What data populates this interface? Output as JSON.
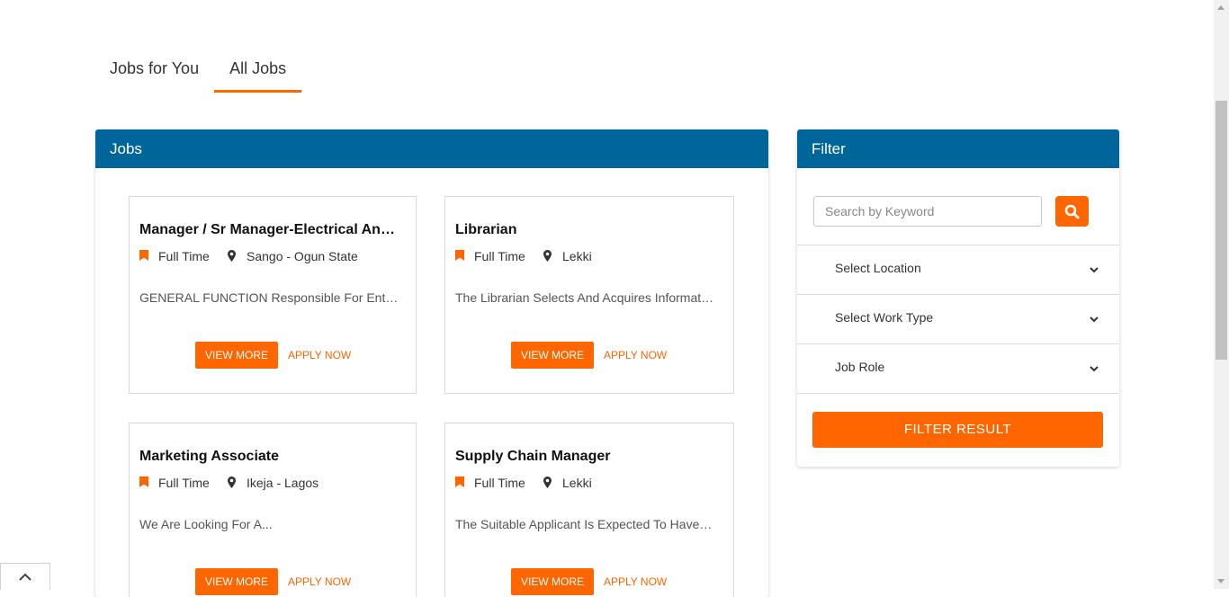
{
  "tabs": [
    {
      "label": "Jobs for You",
      "active": false
    },
    {
      "label": "All Jobs",
      "active": true
    }
  ],
  "jobs_panel": {
    "title": "Jobs",
    "cards": [
      {
        "title": "Manager / Sr Manager-Electrical And...",
        "type": "Full Time",
        "location": "Sango - Ogun State",
        "description": "GENERAL FUNCTION Responsible For Entire...",
        "view_label": "VIEW MORE",
        "apply_label": "APPLY NOW"
      },
      {
        "title": "Librarian",
        "type": "Full Time",
        "location": "Lekki",
        "description": "The Librarian Selects And Acquires Informatio...",
        "view_label": "VIEW MORE",
        "apply_label": "APPLY NOW"
      },
      {
        "title": "Marketing Associate",
        "type": "Full Time",
        "location": "Ikeja - Lagos",
        "description": "We Are Looking For A...",
        "view_label": "VIEW MORE",
        "apply_label": "APPLY NOW"
      },
      {
        "title": "Supply Chain Manager",
        "type": "Full Time",
        "location": "Lekki",
        "description": "The Suitable Applicant Is Expected To Have Th...",
        "view_label": "VIEW MORE",
        "apply_label": "APPLY NOW"
      }
    ]
  },
  "filter_panel": {
    "title": "Filter",
    "search_placeholder": "Search by Keyword",
    "selects": [
      {
        "label": "Select Location"
      },
      {
        "label": "Select Work Type"
      },
      {
        "label": "Job Role"
      }
    ],
    "button_label": "FILTER RESULT"
  },
  "colors": {
    "accent": "#ff6600",
    "header": "#00659a"
  }
}
